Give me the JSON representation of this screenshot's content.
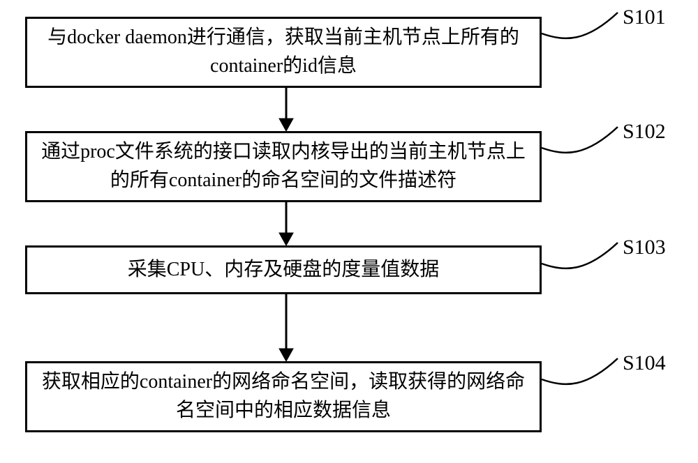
{
  "steps": [
    {
      "id": "S101",
      "text": "与docker daemon进行通信，获取当前主机节点上所有的container的id信息"
    },
    {
      "id": "S102",
      "text": "通过proc文件系统的接口读取内核导出的当前主机节点上的所有container的命名空间的文件描述符"
    },
    {
      "id": "S103",
      "text": "采集CPU、内存及硬盘的度量值数据"
    },
    {
      "id": "S104",
      "text": "获取相应的container的网络命名空间，读取获得的网络命名空间中的相应数据信息"
    }
  ]
}
